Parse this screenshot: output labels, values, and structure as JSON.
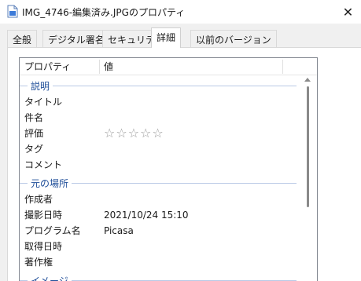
{
  "window": {
    "title": "IMG_4746-編集済み.JPGのプロパティ",
    "close_glyph": "✕",
    "file_icon": "document-icon"
  },
  "tabs": [
    {
      "label": "全般",
      "active": false
    },
    {
      "label": "デジタル署名",
      "active": false
    },
    {
      "label": "セキュリティ",
      "active": false
    },
    {
      "label": "詳細",
      "active": true
    },
    {
      "label": "以前のバージョン",
      "active": false
    }
  ],
  "list": {
    "header": {
      "property": "プロパティ",
      "value": "値"
    },
    "groups": [
      {
        "label": "説明",
        "rows": [
          {
            "name": "タイトル",
            "value": ""
          },
          {
            "name": "件名",
            "value": ""
          },
          {
            "name": "評価",
            "value": "☆☆☆☆☆"
          },
          {
            "name": "タグ",
            "value": ""
          },
          {
            "name": "コメント",
            "value": ""
          }
        ]
      },
      {
        "label": "元の場所",
        "rows": [
          {
            "name": "作成者",
            "value": ""
          },
          {
            "name": "撮影日時",
            "value": "2021/10/24 15:10"
          },
          {
            "name": "プログラム名",
            "value": "Picasa"
          },
          {
            "name": "取得日時",
            "value": ""
          },
          {
            "name": "著作権",
            "value": ""
          }
        ]
      },
      {
        "label": "イメージ",
        "rows": []
      }
    ],
    "rating": {
      "stars": 0,
      "max": 5
    }
  }
}
